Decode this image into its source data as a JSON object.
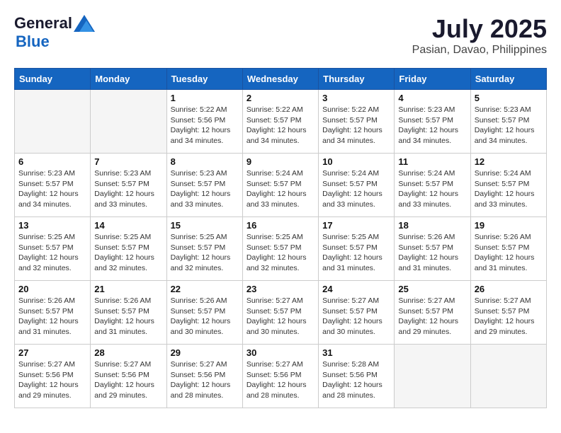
{
  "logo": {
    "general": "General",
    "blue": "Blue"
  },
  "title": {
    "month_year": "July 2025",
    "location": "Pasian, Davao, Philippines"
  },
  "headers": [
    "Sunday",
    "Monday",
    "Tuesday",
    "Wednesday",
    "Thursday",
    "Friday",
    "Saturday"
  ],
  "weeks": [
    [
      {
        "day": "",
        "sunrise": "",
        "sunset": "",
        "daylight": ""
      },
      {
        "day": "",
        "sunrise": "",
        "sunset": "",
        "daylight": ""
      },
      {
        "day": "1",
        "sunrise": "Sunrise: 5:22 AM",
        "sunset": "Sunset: 5:56 PM",
        "daylight": "Daylight: 12 hours and 34 minutes."
      },
      {
        "day": "2",
        "sunrise": "Sunrise: 5:22 AM",
        "sunset": "Sunset: 5:57 PM",
        "daylight": "Daylight: 12 hours and 34 minutes."
      },
      {
        "day": "3",
        "sunrise": "Sunrise: 5:22 AM",
        "sunset": "Sunset: 5:57 PM",
        "daylight": "Daylight: 12 hours and 34 minutes."
      },
      {
        "day": "4",
        "sunrise": "Sunrise: 5:23 AM",
        "sunset": "Sunset: 5:57 PM",
        "daylight": "Daylight: 12 hours and 34 minutes."
      },
      {
        "day": "5",
        "sunrise": "Sunrise: 5:23 AM",
        "sunset": "Sunset: 5:57 PM",
        "daylight": "Daylight: 12 hours and 34 minutes."
      }
    ],
    [
      {
        "day": "6",
        "sunrise": "Sunrise: 5:23 AM",
        "sunset": "Sunset: 5:57 PM",
        "daylight": "Daylight: 12 hours and 34 minutes."
      },
      {
        "day": "7",
        "sunrise": "Sunrise: 5:23 AM",
        "sunset": "Sunset: 5:57 PM",
        "daylight": "Daylight: 12 hours and 33 minutes."
      },
      {
        "day": "8",
        "sunrise": "Sunrise: 5:23 AM",
        "sunset": "Sunset: 5:57 PM",
        "daylight": "Daylight: 12 hours and 33 minutes."
      },
      {
        "day": "9",
        "sunrise": "Sunrise: 5:24 AM",
        "sunset": "Sunset: 5:57 PM",
        "daylight": "Daylight: 12 hours and 33 minutes."
      },
      {
        "day": "10",
        "sunrise": "Sunrise: 5:24 AM",
        "sunset": "Sunset: 5:57 PM",
        "daylight": "Daylight: 12 hours and 33 minutes."
      },
      {
        "day": "11",
        "sunrise": "Sunrise: 5:24 AM",
        "sunset": "Sunset: 5:57 PM",
        "daylight": "Daylight: 12 hours and 33 minutes."
      },
      {
        "day": "12",
        "sunrise": "Sunrise: 5:24 AM",
        "sunset": "Sunset: 5:57 PM",
        "daylight": "Daylight: 12 hours and 33 minutes."
      }
    ],
    [
      {
        "day": "13",
        "sunrise": "Sunrise: 5:25 AM",
        "sunset": "Sunset: 5:57 PM",
        "daylight": "Daylight: 12 hours and 32 minutes."
      },
      {
        "day": "14",
        "sunrise": "Sunrise: 5:25 AM",
        "sunset": "Sunset: 5:57 PM",
        "daylight": "Daylight: 12 hours and 32 minutes."
      },
      {
        "day": "15",
        "sunrise": "Sunrise: 5:25 AM",
        "sunset": "Sunset: 5:57 PM",
        "daylight": "Daylight: 12 hours and 32 minutes."
      },
      {
        "day": "16",
        "sunrise": "Sunrise: 5:25 AM",
        "sunset": "Sunset: 5:57 PM",
        "daylight": "Daylight: 12 hours and 32 minutes."
      },
      {
        "day": "17",
        "sunrise": "Sunrise: 5:25 AM",
        "sunset": "Sunset: 5:57 PM",
        "daylight": "Daylight: 12 hours and 31 minutes."
      },
      {
        "day": "18",
        "sunrise": "Sunrise: 5:26 AM",
        "sunset": "Sunset: 5:57 PM",
        "daylight": "Daylight: 12 hours and 31 minutes."
      },
      {
        "day": "19",
        "sunrise": "Sunrise: 5:26 AM",
        "sunset": "Sunset: 5:57 PM",
        "daylight": "Daylight: 12 hours and 31 minutes."
      }
    ],
    [
      {
        "day": "20",
        "sunrise": "Sunrise: 5:26 AM",
        "sunset": "Sunset: 5:57 PM",
        "daylight": "Daylight: 12 hours and 31 minutes."
      },
      {
        "day": "21",
        "sunrise": "Sunrise: 5:26 AM",
        "sunset": "Sunset: 5:57 PM",
        "daylight": "Daylight: 12 hours and 31 minutes."
      },
      {
        "day": "22",
        "sunrise": "Sunrise: 5:26 AM",
        "sunset": "Sunset: 5:57 PM",
        "daylight": "Daylight: 12 hours and 30 minutes."
      },
      {
        "day": "23",
        "sunrise": "Sunrise: 5:27 AM",
        "sunset": "Sunset: 5:57 PM",
        "daylight": "Daylight: 12 hours and 30 minutes."
      },
      {
        "day": "24",
        "sunrise": "Sunrise: 5:27 AM",
        "sunset": "Sunset: 5:57 PM",
        "daylight": "Daylight: 12 hours and 30 minutes."
      },
      {
        "day": "25",
        "sunrise": "Sunrise: 5:27 AM",
        "sunset": "Sunset: 5:57 PM",
        "daylight": "Daylight: 12 hours and 29 minutes."
      },
      {
        "day": "26",
        "sunrise": "Sunrise: 5:27 AM",
        "sunset": "Sunset: 5:57 PM",
        "daylight": "Daylight: 12 hours and 29 minutes."
      }
    ],
    [
      {
        "day": "27",
        "sunrise": "Sunrise: 5:27 AM",
        "sunset": "Sunset: 5:56 PM",
        "daylight": "Daylight: 12 hours and 29 minutes."
      },
      {
        "day": "28",
        "sunrise": "Sunrise: 5:27 AM",
        "sunset": "Sunset: 5:56 PM",
        "daylight": "Daylight: 12 hours and 29 minutes."
      },
      {
        "day": "29",
        "sunrise": "Sunrise: 5:27 AM",
        "sunset": "Sunset: 5:56 PM",
        "daylight": "Daylight: 12 hours and 28 minutes."
      },
      {
        "day": "30",
        "sunrise": "Sunrise: 5:27 AM",
        "sunset": "Sunset: 5:56 PM",
        "daylight": "Daylight: 12 hours and 28 minutes."
      },
      {
        "day": "31",
        "sunrise": "Sunrise: 5:28 AM",
        "sunset": "Sunset: 5:56 PM",
        "daylight": "Daylight: 12 hours and 28 minutes."
      },
      {
        "day": "",
        "sunrise": "",
        "sunset": "",
        "daylight": ""
      },
      {
        "day": "",
        "sunrise": "",
        "sunset": "",
        "daylight": ""
      }
    ]
  ]
}
